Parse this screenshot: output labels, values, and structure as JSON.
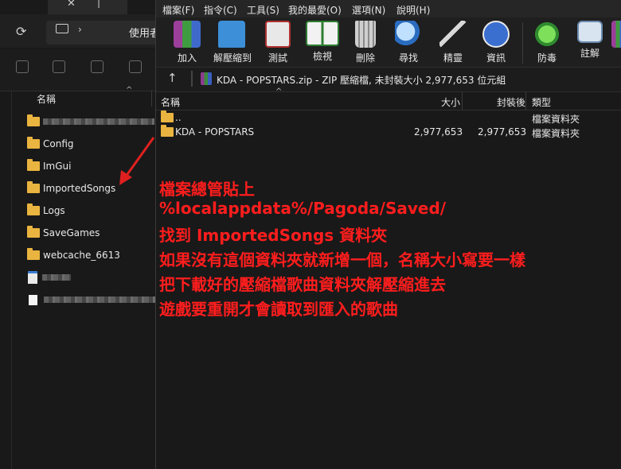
{
  "explorer": {
    "nav": {
      "crumb": "使用者"
    },
    "column_header": "名稱",
    "folders": [
      {
        "label": "Config"
      },
      {
        "label": "ImGui"
      },
      {
        "label": "ImportedSongs"
      },
      {
        "label": "Logs"
      },
      {
        "label": "SaveGames"
      },
      {
        "label": "webcache_6613"
      }
    ]
  },
  "winrar": {
    "menu": [
      "檔案(F)",
      "指令(C)",
      "工具(S)",
      "我的最愛(O)",
      "選項(N)",
      "說明(H)"
    ],
    "toolbar": [
      "加入",
      "解壓縮到",
      "測試",
      "檢視",
      "刪除",
      "尋找",
      "精靈",
      "資訊",
      "防毒",
      "註解"
    ],
    "path": "KDA - POPSTARS.zip - ZIP 壓縮檔, 未封裝大小 2,977,653 位元組",
    "columns": {
      "name": "名稱",
      "size": "大小",
      "packed": "封裝後",
      "type": "類型"
    },
    "rows": [
      {
        "name": "..",
        "size": "",
        "packed": "",
        "type": "檔案資料夾"
      },
      {
        "name": "KDA - POPSTARS",
        "size": "2,977,653",
        "packed": "2,977,653",
        "type": "檔案資料夾"
      }
    ]
  },
  "annotation": [
    "檔案總管貼上",
    "%localappdata%/Pagoda/Saved/",
    "找到 ImportedSongs 資料夾",
    "如果沒有這個資料夾就新增一個，名稱大小寫要一樣",
    "把下載好的壓縮檔歌曲資料夾解壓縮進去",
    "遊戲要重開才會讀取到匯入的歌曲"
  ],
  "colors": {
    "annotation": "#ff1d1d",
    "folder": "#e9b43f",
    "background": "#191919"
  }
}
